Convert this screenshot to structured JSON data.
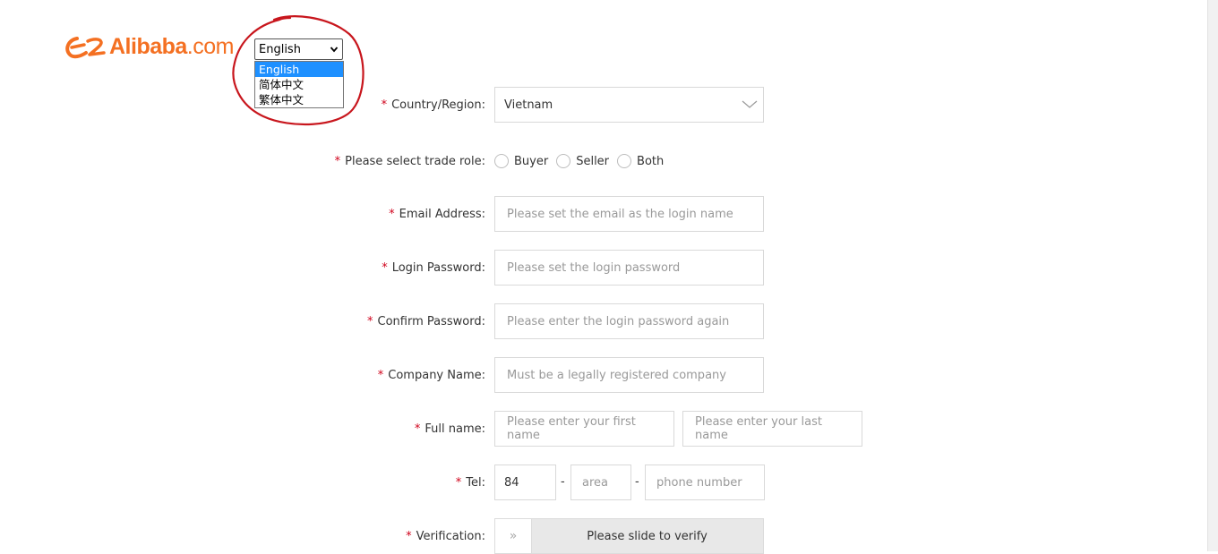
{
  "logo": {
    "text": "Alibaba",
    "suffix": ".com"
  },
  "language": {
    "selected": "English",
    "options": [
      "English",
      "简体中文",
      "繁体中文"
    ],
    "highlight_color": "#1e90ff"
  },
  "form": {
    "required_mark": "*",
    "country": {
      "label": "Country/Region:",
      "value": "Vietnam"
    },
    "trade_role": {
      "label": "Please select trade role:",
      "options": [
        "Buyer",
        "Seller",
        "Both"
      ]
    },
    "email": {
      "label": "Email Address:",
      "placeholder": "Please set the email as the login name"
    },
    "password": {
      "label": "Login Password:",
      "placeholder": "Please set the login password"
    },
    "confirm_password": {
      "label": "Confirm Password:",
      "placeholder": "Please enter the login password again"
    },
    "company": {
      "label": "Company Name:",
      "placeholder": "Must be a legally registered company"
    },
    "full_name": {
      "label": "Full name:",
      "first_placeholder": "Please enter your first name",
      "last_placeholder": "Please enter your last name"
    },
    "tel": {
      "label": "Tel:",
      "country_code": "84",
      "area_placeholder": "area",
      "phone_placeholder": "phone number",
      "separator": "-"
    },
    "verification": {
      "label": "Verification:",
      "slider_text": "Please slide to verify",
      "handle_glyph": "»"
    }
  },
  "colors": {
    "brand": "#f47022",
    "required": "#d0021b",
    "annotation": "#c8161d"
  }
}
